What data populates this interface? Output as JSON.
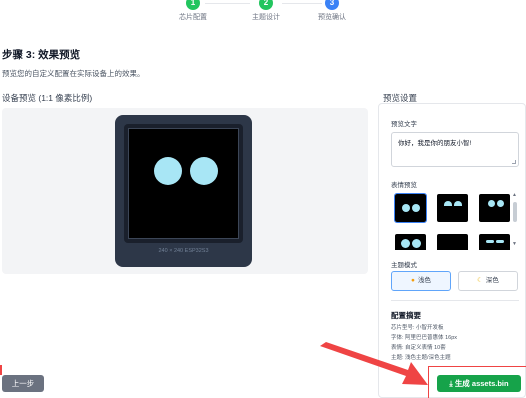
{
  "stepper": {
    "steps": [
      {
        "num": "1",
        "label": "芯片配置",
        "color": "#22c55e"
      },
      {
        "num": "2",
        "label": "主题设计",
        "color": "#22c55e"
      },
      {
        "num": "3",
        "label": "预览确认",
        "color": "#3b82f6"
      }
    ]
  },
  "page": {
    "title": "步骤 3: 效果预览",
    "subtitle": "预览您的自定义配置在实际设备上的效果。"
  },
  "preview": {
    "label": "设备预览 (1:1 像素比例)",
    "device_caption": "240 × 240 ESP32S3"
  },
  "settings": {
    "label": "预览设置",
    "text_label": "预览文字",
    "text_value": "你好，我是你的朋友小智!",
    "emoji_label": "表情预览",
    "theme_label": "主题模式",
    "theme_light": "浅色",
    "theme_dark": "深色",
    "summary_title": "配置摘要",
    "summary_lines": [
      "芯片型号: 小智开发板",
      "字体: 阿里巴巴普惠体 16px",
      "表情: 自定义表情 10套",
      "主题: 浅色主题/深色主题"
    ]
  },
  "actions": {
    "prev": "上一步",
    "generate": "生成 assets.bin"
  },
  "colors": {
    "accent_green": "#16a34a",
    "accent_blue": "#3b82f6",
    "eye": "#a8e6f5",
    "annotation_red": "#ef4444"
  }
}
